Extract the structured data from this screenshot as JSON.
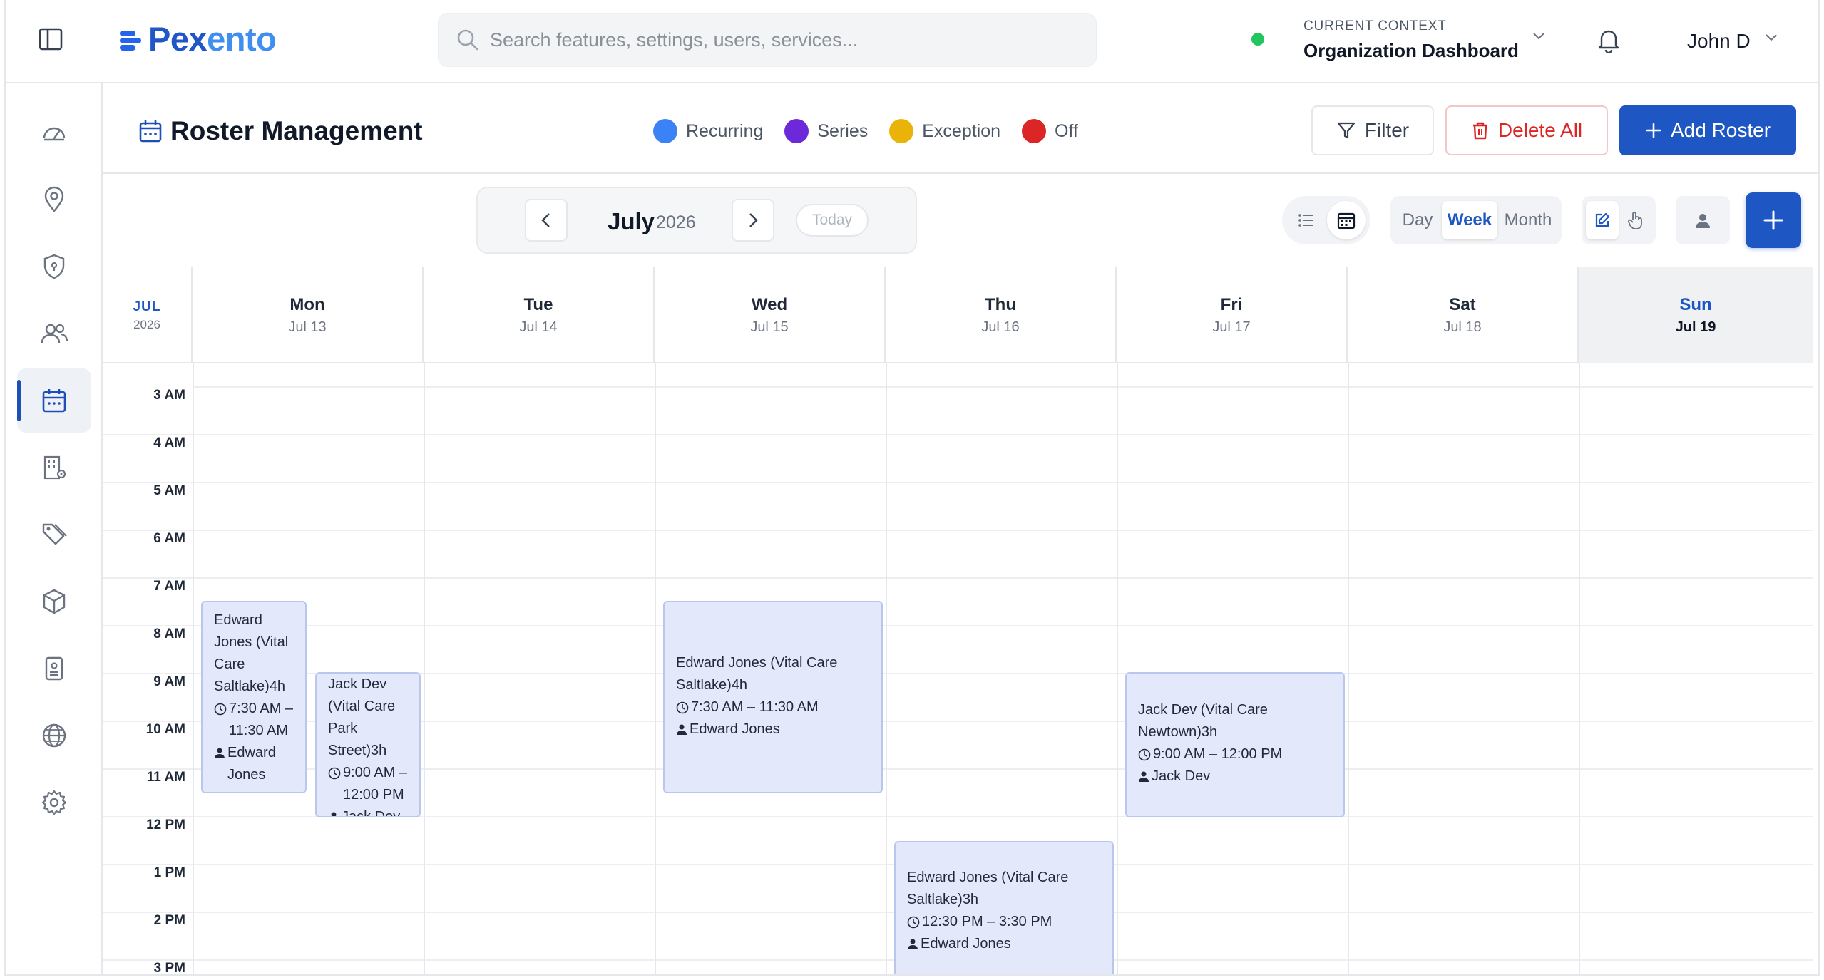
{
  "app": {
    "logo_part1": "Pex",
    "logo_part2": "ento"
  },
  "search": {
    "placeholder": "Search features, settings, users, services..."
  },
  "context": {
    "label": "CURRENT CONTEXT",
    "value": "Organization Dashboard",
    "status_color": "#22c55e"
  },
  "user": {
    "name": "John D"
  },
  "sidebar": {
    "items": [
      {
        "icon": "dashboard-gauge-icon"
      },
      {
        "icon": "location-pin-icon"
      },
      {
        "icon": "shield-icon"
      },
      {
        "icon": "users-icon"
      },
      {
        "icon": "calendar-icon",
        "active": true
      },
      {
        "icon": "building-settings-icon"
      },
      {
        "icon": "tags-icon"
      },
      {
        "icon": "package-box-icon"
      },
      {
        "icon": "id-badge-icon"
      },
      {
        "icon": "globe-icon"
      },
      {
        "icon": "gear-icon"
      }
    ]
  },
  "page": {
    "title": "Roster Management"
  },
  "legend": [
    {
      "label": "Recurring",
      "color": "#3b82f6"
    },
    {
      "label": "Series",
      "color": "#6d28d9"
    },
    {
      "label": "Exception",
      "color": "#eab308"
    },
    {
      "label": "Off",
      "color": "#dc2626"
    }
  ],
  "actions": {
    "filter": "Filter",
    "delete_all": "Delete All",
    "add_roster": "Add Roster"
  },
  "nav": {
    "month": "July",
    "year": "2026",
    "today": "Today"
  },
  "ranges": {
    "day": "Day",
    "week": "Week",
    "month": "Month",
    "selected": "Week"
  },
  "calendar": {
    "corner_month": "JUL",
    "corner_year": "2026",
    "days": [
      {
        "name": "Mon",
        "date": "Jul 13"
      },
      {
        "name": "Tue",
        "date": "Jul 14"
      },
      {
        "name": "Wed",
        "date": "Jul 15"
      },
      {
        "name": "Thu",
        "date": "Jul 16"
      },
      {
        "name": "Fri",
        "date": "Jul 17"
      },
      {
        "name": "Sat",
        "date": "Jul 18"
      },
      {
        "name": "Sun",
        "date": "Jul 19",
        "today": true
      }
    ],
    "hours": [
      "3 AM",
      "4 AM",
      "5 AM",
      "6 AM",
      "7 AM",
      "8 AM",
      "9 AM",
      "10 AM",
      "11 AM",
      "12 PM",
      "1 PM",
      "2 PM",
      "3 PM"
    ],
    "events": [
      {
        "title": "Edward Jones (Vital Care Saltlake)4h",
        "time": "7:30 AM – 11:30 AM",
        "person": "Edward Jones"
      },
      {
        "title": "Jack Dev (Vital Care Park Street)3h",
        "time": "9:00 AM – 12:00 PM",
        "person": "Jack Dev"
      },
      {
        "title": "Edward Jones (Vital Care Saltlake)4h",
        "time": "7:30 AM – 11:30 AM",
        "person": "Edward Jones"
      },
      {
        "title": "Jack Dev (Vital Care Newtown)3h",
        "time": "9:00 AM – 12:00 PM",
        "person": "Jack Dev"
      },
      {
        "title": "Edward Jones (Vital Care Saltlake)3h",
        "time": "12:30 PM – 3:30 PM",
        "person": "Edward Jones"
      }
    ]
  }
}
